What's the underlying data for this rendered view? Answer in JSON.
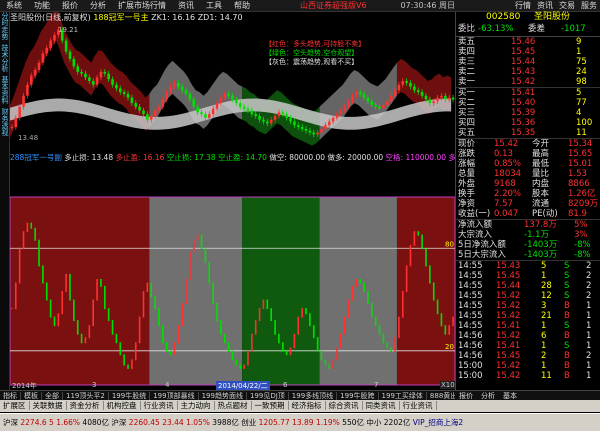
{
  "menu": [
    "系统",
    "功能",
    "报价",
    "分析",
    "扩展市场行情",
    "资讯",
    "工具",
    "帮助"
  ],
  "app_title": "山西证券超强版V6",
  "clock": "07:30:46 周日",
  "right_menu": [
    "行情",
    "资讯",
    "交易",
    "服务"
  ],
  "left_tabs": [
    "分时走势",
    "技术分析",
    "基本资料",
    "财务透视"
  ],
  "chart_title": {
    "stock": "圣阳股份(日线,前复权)",
    "indicator": "188冠军一号主",
    "zk": "ZK1: 16.16",
    "zd": "ZD1: 14.70"
  },
  "price_labels": [
    "19.21",
    "13.48"
  ],
  "legend": {
    "red": "【红色：多头趋势,可持股不卖】",
    "green": "【绿色：空头趋势,空仓观望】",
    "gray": "【灰色：震荡趋势,观看不买】"
  },
  "main_axis": [
    "18.15",
    "17.00",
    "15.85",
    "15.00",
    "14.00",
    "13.00",
    "12.00"
  ],
  "sub_title": {
    "name": "288冠军一号副",
    "stop_loss": "多止损: 13.48",
    "take_profit": "多止盈: 16.16",
    "short_stop": "空止损: 17.38",
    "short_take": "空止盈: 14.70",
    "jk": "做空: 80000.00",
    "jd": "做多: 20000.00",
    "flag": "空格: 110000.00",
    "mode": "多线"
  },
  "sub_axis": [
    "11000",
    "10000",
    "9000",
    "8000",
    "7000",
    "6000",
    "5000",
    "4000",
    "3000",
    "2000",
    "1000"
  ],
  "sub_levels": [
    "80",
    "20"
  ],
  "timeline": {
    "year": "2014年",
    "marks": [
      "3",
      "4",
      "5",
      "6",
      "7"
    ],
    "cursor_date": "2014/04/22/二",
    "x10": "X10"
  },
  "bottom_tabs": [
    "指标",
    "模板",
    "全部",
    "119顶头平2",
    "199牛股统",
    "199顶部暴线",
    "199趋势面线",
    "199见DJ顶",
    "199多线顶线",
    "199牛股跨",
    "199工买绿体",
    "888黄出指标"
  ],
  "right_tabs": [
    "报价",
    "分析",
    "基本"
  ],
  "fn_bar": [
    "扩展区",
    "关联数据",
    "资金分析",
    "机构控盘",
    "行业资讯",
    "主力动向",
    "热点题材",
    "一致预期",
    "经济指标",
    "综合资讯",
    "同类资讯",
    "行业资讯"
  ],
  "status": {
    "sh_label": "沪深",
    "sh": "2274.6",
    "sh_chg": "5",
    "sh_pct": "1.66%",
    "sh_amt": "4080亿",
    "sz_label": "沪深",
    "sz": "2260.45",
    "sz_chg": "23.44",
    "sz_pct": "1.05%",
    "sz_amt": "3988亿",
    "cy_label": "创业",
    "cy": "1205.77",
    "cy_chg": "13.89",
    "cy_pct": "1.19%",
    "cy_amt": "550亿",
    "mid": "中小",
    "mid_amt": "2202亿",
    "vip": "VIP_招商上海2"
  },
  "quote": {
    "code": "002580",
    "name": "圣阳股份",
    "webi_label": "委比",
    "webi": "-63.13%",
    "wecha_label": "委差",
    "wecha": "-1017",
    "asks": [
      [
        "卖五",
        "15.46",
        "9"
      ],
      [
        "卖四",
        "15.45",
        "1"
      ],
      [
        "卖三",
        "15.44",
        "75"
      ],
      [
        "卖二",
        "15.43",
        "24"
      ],
      [
        "卖一",
        "15.42",
        "98"
      ]
    ],
    "bids": [
      [
        "买一",
        "15.41",
        "5"
      ],
      [
        "买二",
        "15.40",
        "77"
      ],
      [
        "买三",
        "15.39",
        "4"
      ],
      [
        "买四",
        "15.36",
        "100"
      ],
      [
        "买五",
        "15.35",
        "11"
      ]
    ],
    "stats": [
      [
        "现价",
        "15.42",
        "今开",
        "15.34"
      ],
      [
        "涨跌",
        "0.13",
        "最高",
        "15.65"
      ],
      [
        "涨幅",
        "0.85%",
        "最低",
        "15.01"
      ],
      [
        "总量",
        "18034",
        "量比",
        "1.53"
      ],
      [
        "外盘",
        "9168",
        "内盘",
        "8866"
      ],
      [
        "换手",
        "2.20%",
        "股本",
        "1.26亿"
      ],
      [
        "净资",
        "7.57",
        "流通",
        "8209万"
      ],
      [
        "收益(一)",
        "0.047",
        "PE(动)",
        "81.9"
      ]
    ],
    "flows": [
      [
        "净流入额",
        "137.8万",
        "5%"
      ],
      [
        "大宗流入",
        "-1.1万",
        "3%"
      ],
      [
        "5日净流入额",
        "-1403万",
        "-8%"
      ],
      [
        "5日大宗流入",
        "-1403万",
        "-8%"
      ]
    ],
    "ticks": [
      [
        "14:55",
        "15.43",
        "5",
        "S",
        "2"
      ],
      [
        "14:55",
        "15.45",
        "1",
        "S",
        "2"
      ],
      [
        "14:55",
        "15.44",
        "28",
        "S",
        "2"
      ],
      [
        "14:55",
        "15.42",
        "12",
        "S",
        "2"
      ],
      [
        "14:55",
        "15.42",
        "3",
        "B",
        "1"
      ],
      [
        "14:55",
        "15.42",
        "21",
        "B",
        "1"
      ],
      [
        "14:55",
        "15.41",
        "1",
        "S",
        "1"
      ],
      [
        "14:56",
        "15.42",
        "6",
        "B",
        "1"
      ],
      [
        "14:56",
        "15.41",
        "1",
        "S",
        "1"
      ],
      [
        "14:56",
        "15.45",
        "2",
        "B",
        "2"
      ],
      [
        "15:00",
        "15.42",
        "1",
        "B",
        "1"
      ],
      [
        "15:00",
        "15.42",
        "11",
        "B",
        "1"
      ]
    ]
  },
  "colors": {
    "red_zone": "#7a1010",
    "gray_zone": "#707070",
    "green_zone": "#0f5a0f",
    "up": "#ff3030",
    "down": "#00e000",
    "bg": "#000000"
  },
  "chart_data": {
    "type": "candlestick",
    "zones": [
      {
        "color": "red",
        "from": 0,
        "to": 36
      },
      {
        "color": "gray",
        "from": 36,
        "to": 60
      },
      {
        "color": "green",
        "from": 60,
        "to": 80
      },
      {
        "color": "gray",
        "from": 80,
        "to": 100
      },
      {
        "color": "red",
        "from": 100,
        "to": 115
      }
    ],
    "close": [
      13.9,
      14.4,
      15.0,
      15.6,
      16.2,
      16.7,
      17.0,
      17.4,
      17.9,
      18.2,
      18.6,
      18.9,
      19.2,
      18.6,
      18.0,
      17.6,
      17.2,
      16.9,
      16.8,
      16.6,
      16.4,
      16.2,
      16.6,
      16.9,
      16.8,
      16.5,
      16.2,
      16.0,
      15.8,
      15.7,
      15.5,
      15.2,
      15.0,
      14.8,
      14.6,
      14.3,
      14.5,
      14.8,
      15.0,
      15.4,
      15.8,
      16.1,
      16.3,
      16.1,
      15.9,
      15.7,
      15.4,
      15.0,
      14.7,
      14.6,
      14.4,
      14.6,
      14.9,
      15.2,
      15.5,
      15.7,
      15.6,
      15.4,
      15.2,
      15.0,
      14.9,
      14.8,
      14.6,
      14.5,
      14.3,
      14.2,
      14.1,
      14.3,
      14.5,
      14.7,
      14.6,
      14.4,
      14.2,
      14.0,
      13.9,
      13.8,
      13.7,
      13.6,
      13.5,
      13.6,
      13.8,
      14.0,
      14.2,
      14.4,
      14.6,
      14.8,
      15.0,
      15.3,
      15.6,
      15.8,
      15.7,
      15.5,
      15.3,
      15.1,
      15.0,
      14.9,
      15.1,
      15.3,
      15.6,
      15.9,
      16.2,
      16.4,
      16.3,
      16.1,
      15.9,
      15.8,
      15.6,
      15.4,
      15.2,
      15.3,
      15.5,
      15.6,
      15.4,
      15.5,
      15.4
    ],
    "ylim": [
      12.0,
      19.5
    ],
    "indicator": [
      45,
      60,
      80,
      90,
      95,
      92,
      85,
      70,
      60,
      50,
      40,
      35,
      42,
      55,
      65,
      50,
      38,
      30,
      25,
      28,
      35,
      50,
      62,
      58,
      45,
      38,
      30,
      25,
      18,
      12,
      10,
      15,
      25,
      40,
      55,
      60,
      52,
      45,
      35,
      25,
      20,
      18,
      25,
      35,
      48,
      62,
      78,
      85,
      88,
      80,
      72,
      60,
      48,
      38,
      30,
      25,
      20,
      15,
      12,
      10,
      12,
      20,
      30,
      38,
      45,
      50,
      45,
      38,
      30,
      25,
      20,
      18,
      22,
      30,
      40,
      45,
      42,
      35,
      28,
      20,
      15,
      12,
      10,
      15,
      22,
      30,
      40,
      50,
      58,
      62,
      60,
      55,
      48,
      40,
      35,
      30,
      25,
      22,
      20,
      28,
      40,
      55,
      70,
      82,
      90,
      88,
      80,
      70,
      60,
      50,
      42,
      35,
      30,
      35,
      40
    ],
    "indicator_ylim": [
      0,
      110
    ]
  }
}
